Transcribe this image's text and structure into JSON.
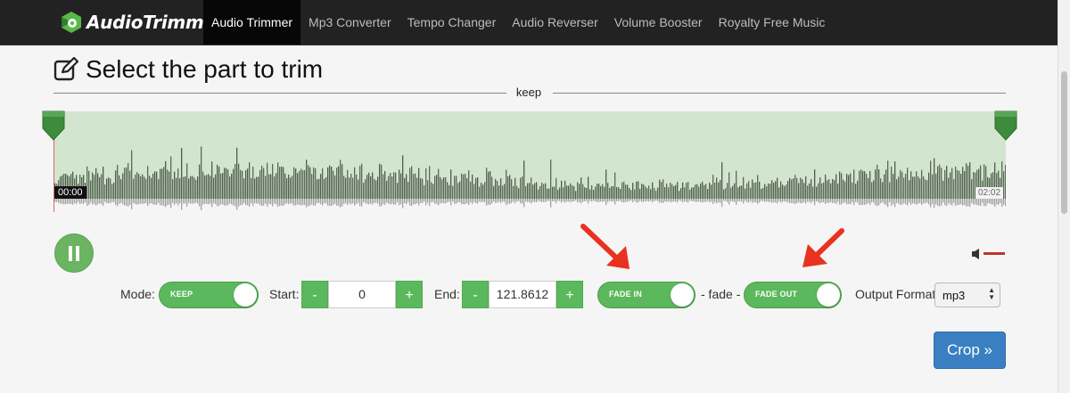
{
  "brand": {
    "name": "AudioTrimmer"
  },
  "nav": {
    "items": [
      "Audio Trimmer",
      "Mp3 Converter",
      "Tempo Changer",
      "Audio Reverser",
      "Volume Booster",
      "Royalty Free Music"
    ],
    "active_index": 0
  },
  "page": {
    "title": "Select the part to trim",
    "edit_icon": "edit-square-icon"
  },
  "divider": {
    "label": "keep"
  },
  "player": {
    "start_time": "00:00",
    "end_time": "02:02",
    "play_state_icon": "pause-icon",
    "volume_icon": "speaker-icon"
  },
  "controls": {
    "mode_label": "Mode:",
    "mode_value": "KEEP",
    "start_label": "Start:",
    "start_value": "0",
    "end_label": "End:",
    "end_value": "121.8612",
    "minus": "-",
    "plus": "+",
    "fade_in": "FADE IN",
    "fade_sep": "- fade -",
    "fade_out": "FADE OUT",
    "output_label": "Output Format",
    "output_value": "mp3"
  },
  "crop_button": "Crop »",
  "colors": {
    "brand_green": "#5cb85c",
    "crop_blue": "#3a7fc1",
    "annotation_red": "#e8321f",
    "nav_bg": "#222222"
  }
}
